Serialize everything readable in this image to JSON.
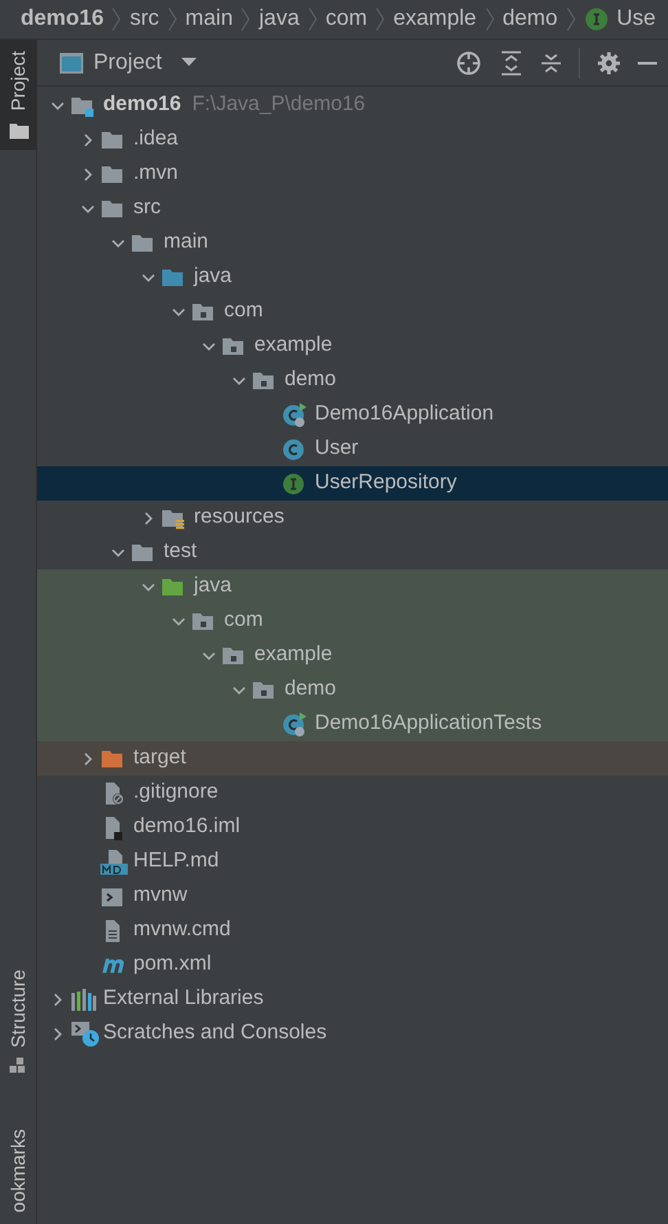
{
  "breadcrumbs": [
    {
      "label": "demo16",
      "kind": "module"
    },
    {
      "label": "src",
      "kind": "plain"
    },
    {
      "label": "main",
      "kind": "plain"
    },
    {
      "label": "java",
      "kind": "plain"
    },
    {
      "label": "com",
      "kind": "plain"
    },
    {
      "label": "example",
      "kind": "plain"
    },
    {
      "label": "demo",
      "kind": "plain"
    },
    {
      "label": "Use",
      "kind": "interface"
    }
  ],
  "left_strip": {
    "tabs": [
      {
        "label": "Project",
        "selected": true,
        "bottom": false
      },
      {
        "label": "Structure",
        "selected": false,
        "bottom": true
      },
      {
        "label": "ookmarks",
        "selected": false,
        "bottom": true
      }
    ]
  },
  "panel": {
    "title": "Project"
  },
  "tree": [
    {
      "name": "demo16",
      "path": "F:\\Java_P\\demo16",
      "kind": "module",
      "expanded": true,
      "children": [
        {
          "name": ".idea",
          "kind": "folder",
          "expanded": false
        },
        {
          "name": ".mvn",
          "kind": "folder",
          "expanded": false
        },
        {
          "name": "src",
          "kind": "folder",
          "expanded": true,
          "children": [
            {
              "name": "main",
              "kind": "folder",
              "expanded": true,
              "children": [
                {
                  "name": "java",
                  "kind": "source-root",
                  "expanded": true,
                  "children": [
                    {
                      "name": "com",
                      "kind": "package",
                      "expanded": true,
                      "children": [
                        {
                          "name": "example",
                          "kind": "package",
                          "expanded": true,
                          "children": [
                            {
                              "name": "demo",
                              "kind": "package",
                              "expanded": true,
                              "children": [
                                {
                                  "name": "Demo16Application",
                                  "kind": "spring-class",
                                  "selected": false
                                },
                                {
                                  "name": "User",
                                  "kind": "class",
                                  "selected": false
                                },
                                {
                                  "name": "UserRepository",
                                  "kind": "interface",
                                  "selected": true
                                }
                              ]
                            }
                          ]
                        }
                      ]
                    }
                  ]
                },
                {
                  "name": "resources",
                  "kind": "resources",
                  "expanded": false
                }
              ]
            },
            {
              "name": "test",
              "kind": "folder",
              "expanded": true,
              "children": [
                {
                  "name": "java",
                  "kind": "test-root",
                  "in_test": true,
                  "expanded": true,
                  "children": [
                    {
                      "name": "com",
                      "kind": "package",
                      "in_test": true,
                      "expanded": true,
                      "children": [
                        {
                          "name": "example",
                          "kind": "package",
                          "in_test": true,
                          "expanded": true,
                          "children": [
                            {
                              "name": "demo",
                              "kind": "package",
                              "in_test": true,
                              "expanded": true,
                              "children": [
                                {
                                  "name": "Demo16ApplicationTests",
                                  "kind": "spring-class",
                                  "in_test": true,
                                  "selected": false
                                }
                              ]
                            }
                          ]
                        }
                      ]
                    }
                  ]
                }
              ]
            }
          ]
        },
        {
          "name": "target",
          "kind": "excluded",
          "expanded": false
        },
        {
          "name": ".gitignore",
          "kind": "ignore-file",
          "selected": false
        },
        {
          "name": "demo16.iml",
          "kind": "iml-file",
          "selected": false
        },
        {
          "name": "HELP.md",
          "kind": "md-file",
          "selected": false
        },
        {
          "name": "mvnw",
          "kind": "shell-file",
          "selected": false
        },
        {
          "name": "mvnw.cmd",
          "kind": "text-file",
          "selected": false
        },
        {
          "name": "pom.xml",
          "kind": "maven-file",
          "selected": false
        }
      ]
    },
    {
      "name": "External Libraries",
      "kind": "libraries",
      "expanded": false
    },
    {
      "name": "Scratches and Consoles",
      "kind": "scratches",
      "expanded": false
    }
  ]
}
